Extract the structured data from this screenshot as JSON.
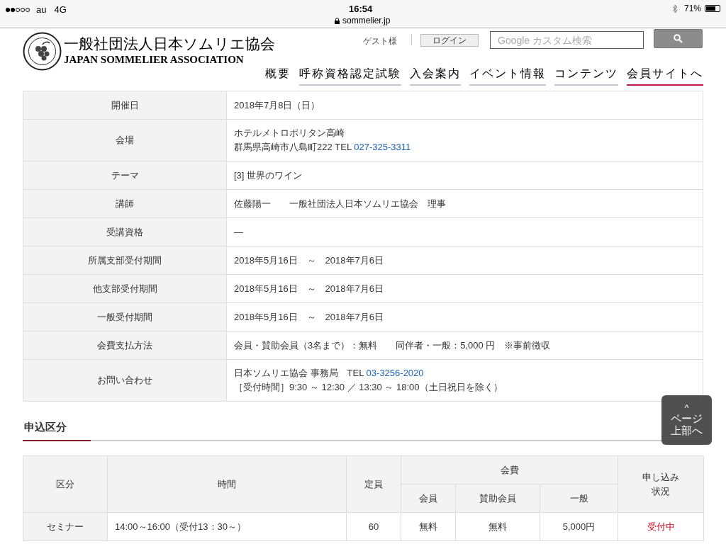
{
  "status_bar": {
    "carrier": "au",
    "network": "4G",
    "time": "16:54",
    "url": "sommelier.jp",
    "battery": "71%"
  },
  "header": {
    "logo_jp": "一般社団法人日本ソムリエ協会",
    "logo_en": "JAPAN SOMMELIER ASSOCIATION",
    "guest": "ゲスト様",
    "login": "ログイン",
    "search": {
      "placeholder": "Google カスタム検索"
    },
    "nav": [
      {
        "label": "概要",
        "kind": "plain"
      },
      {
        "label": "呼称資格認定試験",
        "kind": "menu"
      },
      {
        "label": "入会案内",
        "kind": "menu"
      },
      {
        "label": "イベント情報",
        "kind": "menu"
      },
      {
        "label": "コンテンツ",
        "kind": "menu"
      },
      {
        "label": "会員サイトへ",
        "kind": "external"
      }
    ]
  },
  "details": [
    {
      "label": "開催日",
      "lines": [
        [
          "2018年7月8日（日）"
        ]
      ]
    },
    {
      "label": "会場",
      "lines": [
        [
          "ホテルメトロポリタン高崎"
        ],
        [
          "群馬県高崎市八島町222 TEL ",
          {
            "link": "027-325-3311"
          }
        ]
      ]
    },
    {
      "label": "テーマ",
      "lines": [
        [
          "[3] 世界のワイン"
        ]
      ]
    },
    {
      "label": "講師",
      "lines": [
        [
          "佐藤陽一　　一般社団法人日本ソムリエ協会　理事"
        ]
      ]
    },
    {
      "label": "受講資格",
      "lines": [
        [
          "—"
        ]
      ]
    },
    {
      "label": "所属支部受付期間",
      "lines": [
        [
          "2018年5月16日　～　2018年7月6日"
        ]
      ]
    },
    {
      "label": "他支部受付期間",
      "lines": [
        [
          "2018年5月16日　～　2018年7月6日"
        ]
      ]
    },
    {
      "label": "一般受付期間",
      "lines": [
        [
          "2018年5月16日　～　2018年7月6日"
        ]
      ]
    },
    {
      "label": "会費支払方法",
      "lines": [
        [
          "会員・賛助会員（3名まで）：無料　　同伴者・一般：5,000 円　※事前徴収"
        ]
      ]
    },
    {
      "label": "お問い合わせ",
      "lines": [
        [
          "日本ソムリエ協会 事務局　TEL ",
          {
            "link": "03-3256-2020"
          }
        ],
        [
          "［受付時間］9:30 ～ 12:30 ／ 13:30 ～ 18:00（土日祝日を除く）"
        ]
      ]
    }
  ],
  "section_title": "申込区分",
  "fees_table": {
    "columns": {
      "category": "区分",
      "time": "時間",
      "capacity": "定員",
      "fee": "会費",
      "fee_member": "会員",
      "fee_supporting": "賛助会員",
      "fee_general": "一般",
      "status": "申し込み状況"
    },
    "rows": [
      {
        "category": "セミナー",
        "time": "14:00～16:00（受付13：30～）",
        "capacity": "60",
        "fee_member": "無料",
        "fee_supporting": "無料",
        "fee_general": "5,000円",
        "status": "受付中"
      }
    ]
  },
  "page_top": {
    "arrow": "^",
    "label": "ページ上部へ"
  }
}
